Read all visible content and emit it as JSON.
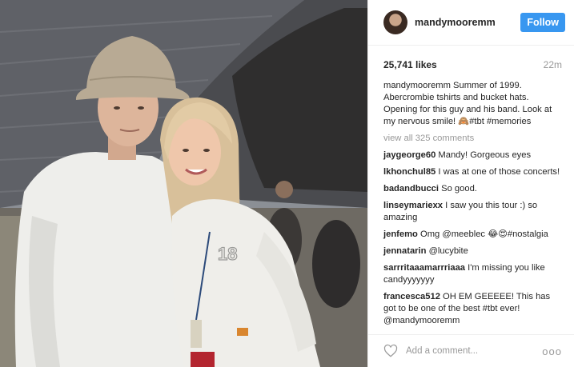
{
  "header": {
    "username": "mandymooremm",
    "follow_label": "Follow"
  },
  "meta": {
    "likes": "25,741 likes",
    "time": "22m"
  },
  "caption": {
    "username": "mandymooremm",
    "text": " Summer of 1999. Abercrombie tshirts and bucket hats. Opening for this guy and his band. Look at my nervous smile! 🙈#tbt #memories"
  },
  "view_all": "view all 325 comments",
  "comments": [
    {
      "user": "jaygeorge60",
      "text": " Mandy! Gorgeous eyes"
    },
    {
      "user": "lkhonchul85",
      "text": " I was at one of those concerts!"
    },
    {
      "user": "badandbucci",
      "text": " So good."
    },
    {
      "user": "linseymariexx",
      "text": " I saw you this tour :) so amazing"
    },
    {
      "user": "jenfemo",
      "text": " Omg @meeblec 😂😍#nostalgia"
    },
    {
      "user": "jennatarin",
      "text": " @lucybite"
    },
    {
      "user": "sarrritaaamarrriaaa",
      "text": " I'm missing you like candyyyyyyy"
    },
    {
      "user": "francesca512",
      "text": " OH EM GEEEEE! This has got to be one of the best #tbt ever! @mandymooremm"
    }
  ],
  "add_comment": {
    "placeholder": "Add a comment...",
    "more": "ooo"
  },
  "photo": {
    "shirt_number": "18"
  },
  "icons": {
    "heart": "heart-icon",
    "more": "more-options-icon"
  },
  "colors": {
    "follow_button": "#3897f0",
    "muted_text": "#999999"
  }
}
